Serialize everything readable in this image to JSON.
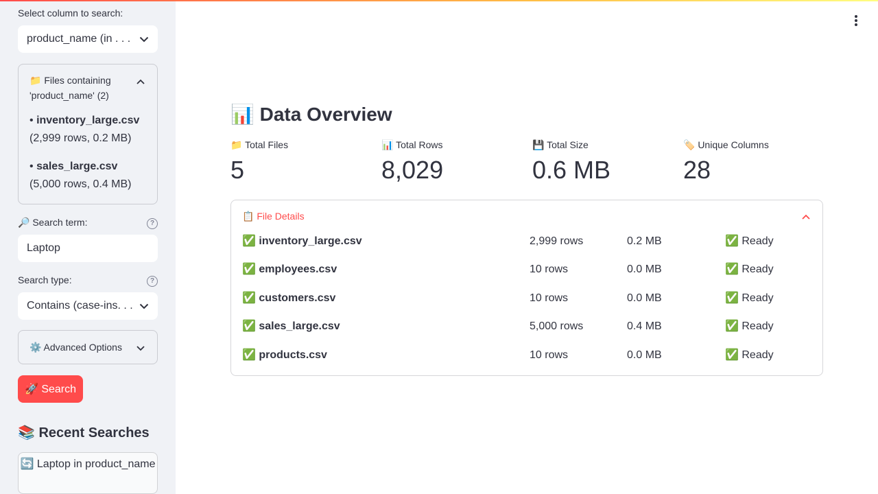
{
  "sidebar": {
    "column_label": "Select column to search:",
    "column_value": "product_name (in . . .",
    "files_expander": {
      "icon": "📁",
      "title": "Files containing 'product_name' (2)",
      "items": [
        {
          "bullet": "•",
          "name": "inventory_large.csv",
          "info": "(2,999 rows, 0.2 MB)"
        },
        {
          "bullet": "•",
          "name": "sales_large.csv",
          "info": "(5,000 rows, 0.4 MB)"
        }
      ]
    },
    "search_term_label": "🔎 Search term:",
    "search_term_value": "Laptop",
    "search_type_label": "Search type:",
    "search_type_value": "Contains (case-ins. . .",
    "advanced_label": "⚙️ Advanced Options",
    "search_button": "🚀 Search",
    "recent_title": "📚 Recent Searches",
    "recent_item": "🔄 Laptop in product_name",
    "help_glyph": "?"
  },
  "main": {
    "title": "📊 Data Overview",
    "metrics": [
      {
        "label": "📁 Total Files",
        "value": "5"
      },
      {
        "label": "📊 Total Rows",
        "value": "8,029"
      },
      {
        "label": "💾 Total Size",
        "value": "0.6 MB"
      },
      {
        "label": "🏷️ Unique Columns",
        "value": "28"
      }
    ],
    "file_details": {
      "title": "📋 File Details",
      "rows": [
        {
          "name": "✅ inventory_large.csv",
          "rows": "2,999 rows",
          "size": "0.2 MB",
          "status": "✅ Ready"
        },
        {
          "name": "✅ employees.csv",
          "rows": "10 rows",
          "size": "0.0 MB",
          "status": "✅ Ready"
        },
        {
          "name": "✅ customers.csv",
          "rows": "10 rows",
          "size": "0.0 MB",
          "status": "✅ Ready"
        },
        {
          "name": "✅ sales_large.csv",
          "rows": "5,000 rows",
          "size": "0.4 MB",
          "status": "✅ Ready"
        },
        {
          "name": "✅ products.csv",
          "rows": "10 rows",
          "size": "0.0 MB",
          "status": "✅ Ready"
        }
      ]
    }
  },
  "colors": {
    "accent": "#ff4b4b",
    "sidebar_bg": "#f0f2f6",
    "text": "#31333f"
  }
}
